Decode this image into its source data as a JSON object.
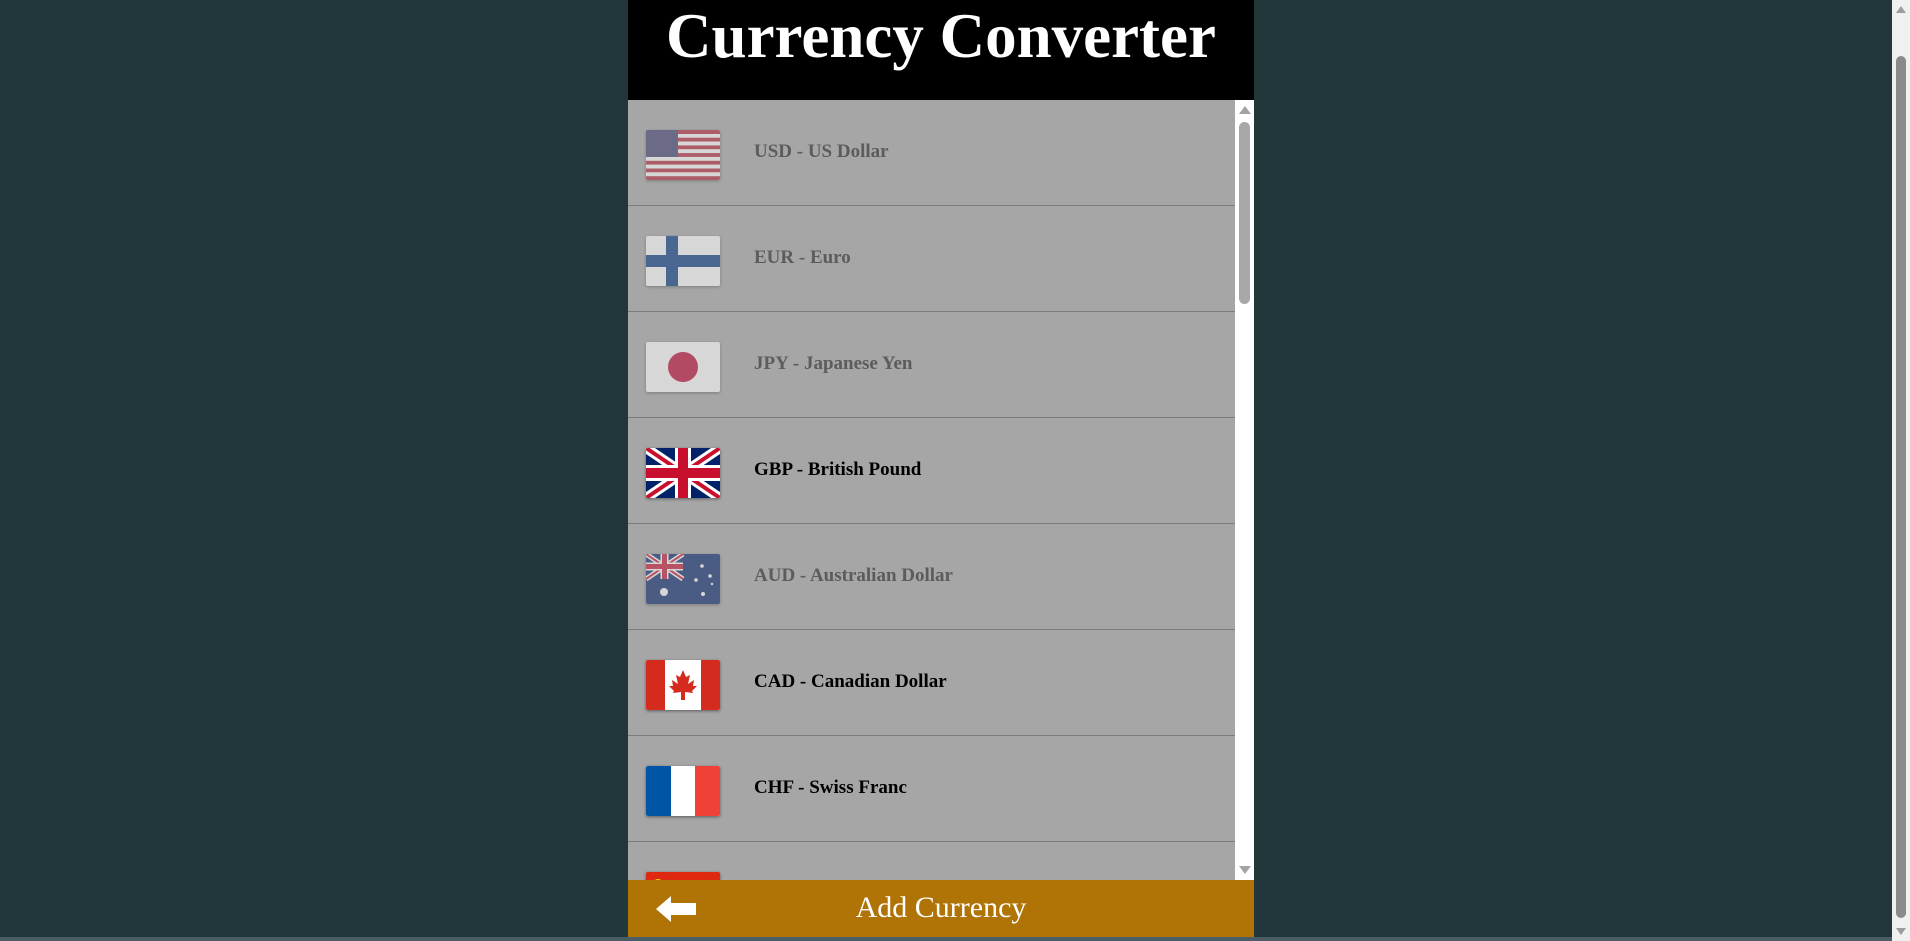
{
  "app": {
    "title": "Currency Converter"
  },
  "currency_list": {
    "items": [
      {
        "code_label": "USD - US Dollar",
        "flag": "us-flag-icon",
        "selected": true
      },
      {
        "code_label": "EUR - Euro",
        "flag": "finland-flag-icon",
        "selected": true
      },
      {
        "code_label": "JPY - Japanese Yen",
        "flag": "japan-flag-icon",
        "selected": true
      },
      {
        "code_label": "GBP - British Pound",
        "flag": "uk-flag-icon",
        "selected": false
      },
      {
        "code_label": "AUD - Australian Dollar",
        "flag": "australia-flag-icon",
        "selected": true
      },
      {
        "code_label": "CAD - Canadian Dollar",
        "flag": "canada-flag-icon",
        "selected": false
      },
      {
        "code_label": "CHF - Swiss Franc",
        "flag": "france-flag-icon",
        "selected": false
      }
    ]
  },
  "footer": {
    "title": "Add Currency",
    "back_icon": "back-arrow-icon"
  },
  "colors": {
    "page_background": "#21373a",
    "header_background": "#000000",
    "list_background": "#a6a6a6",
    "footer_background": "#b07305",
    "enabled_text": "#000000",
    "dimmed_text": "#5c5c5c"
  }
}
